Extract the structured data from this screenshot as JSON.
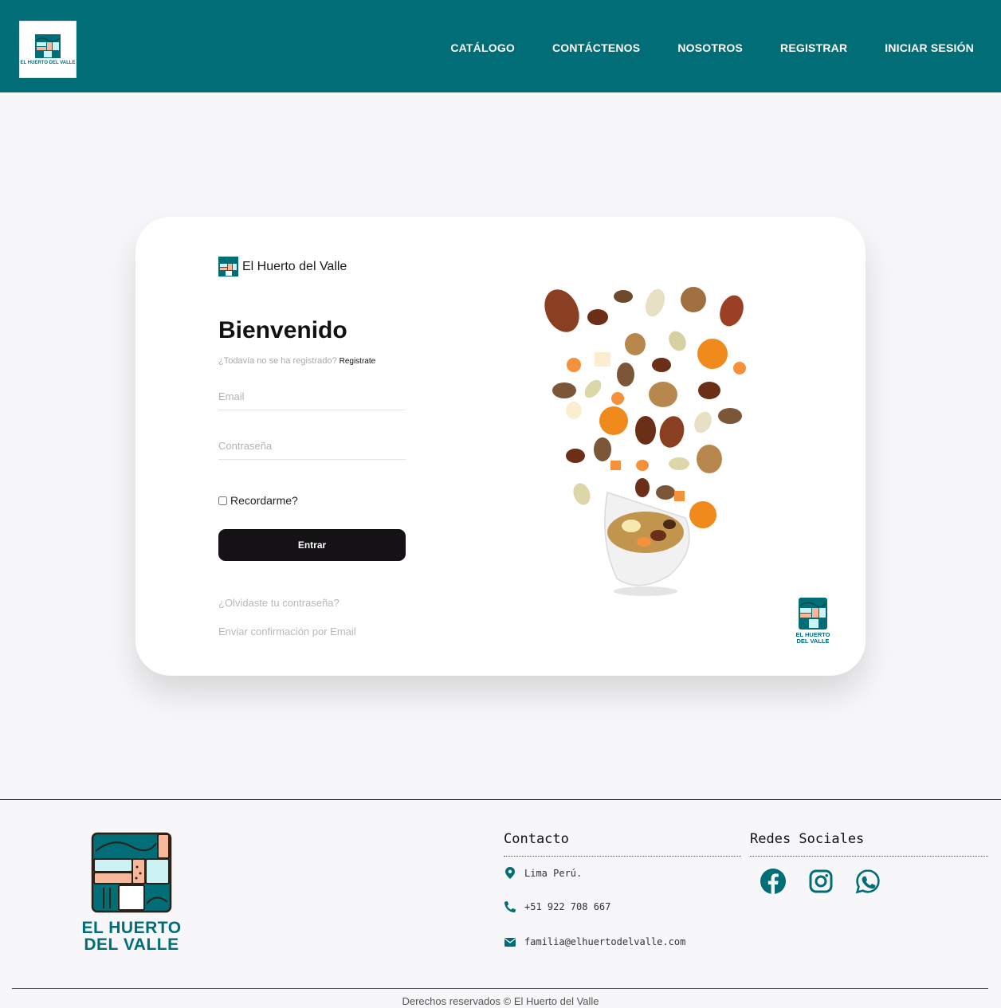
{
  "header": {
    "logo_text": "EL HUERTO DEL VALLE",
    "nav": [
      "CATÁLOGO",
      "CONTÁCTENOS",
      "NOSOTROS",
      "REGISTRAR",
      "INICIAR SESIÓN"
    ]
  },
  "login": {
    "brand_name": "El Huerto del Valle",
    "title": "Bienvenido",
    "signup_prompt": "¿Todavía no se ha registrado?",
    "signup_link": "Registrate",
    "email_placeholder": "Email",
    "password_placeholder": "Contraseña",
    "remember_label": "Recordarme?",
    "submit_label": "Entrar",
    "forgot_link": "¿Olvidaste tu contraseña?",
    "confirm_link": "Enviar confirmación por Email",
    "image_logo_text": "EL HUERTO DEL VALLE"
  },
  "footer": {
    "logo_line1": "EL HUERTO",
    "logo_line2": "DEL VALLE",
    "contact_title": "Contacto",
    "location": "Lima Perú.",
    "phone": "+51 922 708 667",
    "email": "familia@elhuertodelvalle.com",
    "social_title": "Redes Sociales",
    "social_icons": [
      "facebook-icon",
      "instagram-icon",
      "whatsapp-icon"
    ],
    "copyright": "Derechos reservados © El Huerto del Valle"
  },
  "colors": {
    "brand_teal": "#006d77",
    "button_dark": "#141214",
    "page_bg": "#f7f6f8"
  }
}
